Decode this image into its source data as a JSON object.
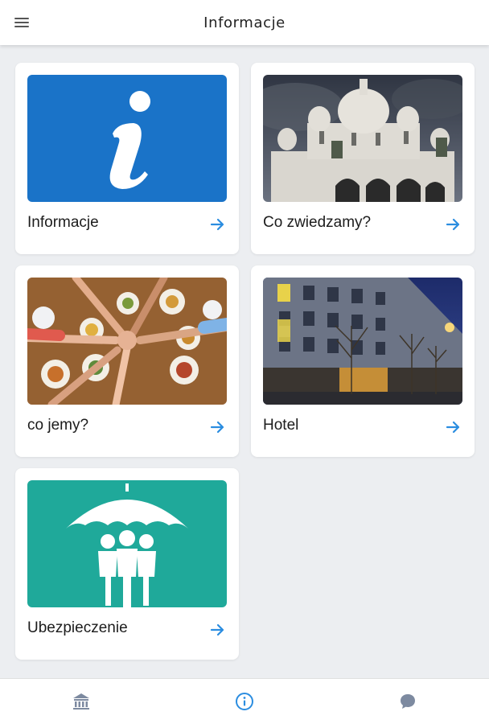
{
  "header": {
    "title": "Informacje",
    "menu_icon": "menu-icon"
  },
  "cards": [
    {
      "label": "Informacje",
      "image": "info-icon",
      "image_color": "#1a73c8"
    },
    {
      "label": "Co zwiedzamy?",
      "image": "basilica-photo"
    },
    {
      "label": "co jemy?",
      "image": "dining-table-photo"
    },
    {
      "label": "Hotel",
      "image": "hotel-photo"
    },
    {
      "label": "Ubezpieczenie",
      "image": "umbrella-family-icon",
      "image_color": "#1fa99a"
    }
  ],
  "bottom_nav": [
    {
      "icon": "bank-icon",
      "active": false
    },
    {
      "icon": "info-circle-icon",
      "active": true
    },
    {
      "icon": "chat-bubble-icon",
      "active": false
    }
  ],
  "colors": {
    "accent": "#2b8de0",
    "background": "#eceef1",
    "inactive_icon": "#7d8aa0"
  }
}
